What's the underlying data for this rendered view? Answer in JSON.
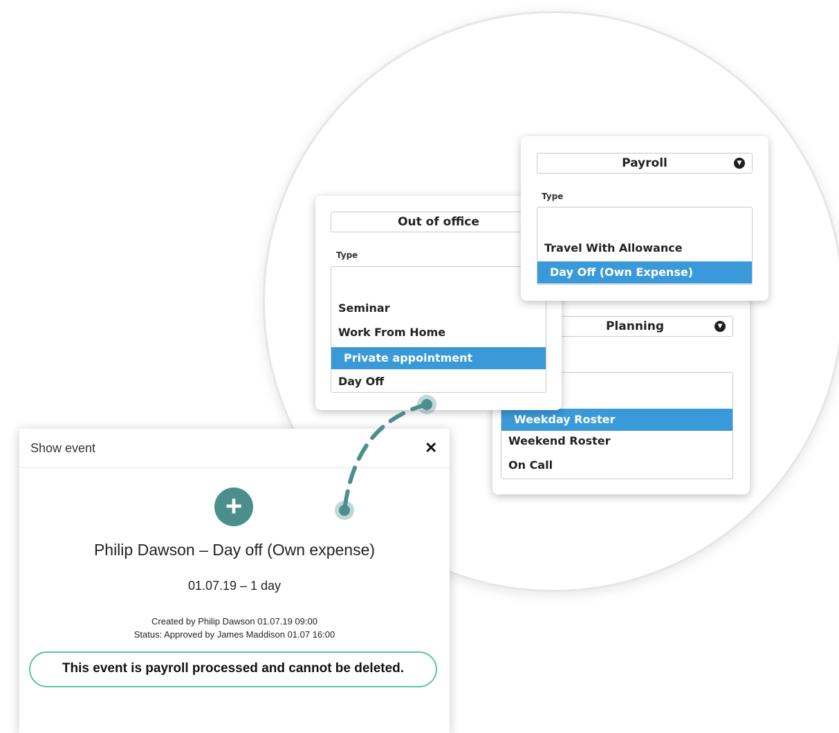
{
  "colors": {
    "accent_teal": "#4a8f8c",
    "highlight_blue": "#3a9ad9",
    "notice_border": "#5bc4a6"
  },
  "payroll_panel": {
    "select_value": "Payroll",
    "type_label": "Type",
    "options": [
      "Travel With Allowance",
      "Day Off (Own Expense)"
    ],
    "selected_option": "Day Off (Own Expense)"
  },
  "office_panel": {
    "select_value": "Out of office",
    "type_label": "Type",
    "options": [
      "Seminar",
      "Work From Home",
      "Private appointment",
      "Day Off"
    ],
    "selected_option": "Private appointment"
  },
  "planning_panel": {
    "select_value": "Planning",
    "options": [
      "Weekday Roster",
      "Weekend Roster",
      "On Call"
    ],
    "selected_option": "Weekday Roster"
  },
  "dialog": {
    "title": "Show event",
    "close_icon": "close-icon",
    "add_icon": "plus-icon",
    "event_title": "Philip Dawson – Day off (Own expense)",
    "event_date": "01.07.19 – 1 day",
    "created_by": "Created by Philip Dawson 01.07.19 09:00",
    "status": "Status: Approved by James Maddison 01.07 16:00",
    "notice": "This event is payroll processed and cannot be deleted."
  }
}
